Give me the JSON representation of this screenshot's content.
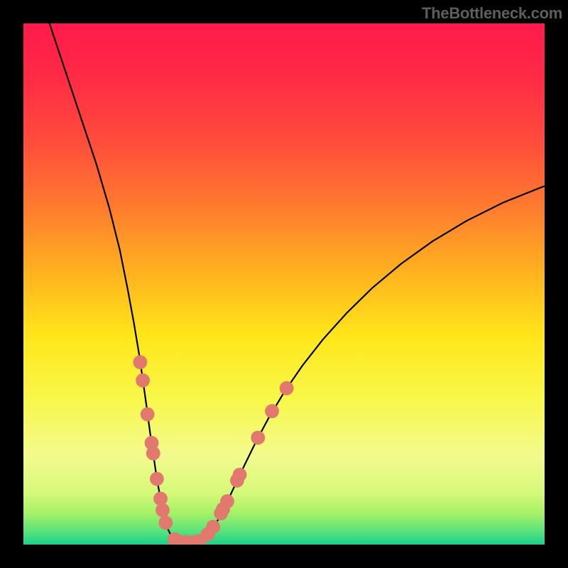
{
  "watermark": "TheBottleneck.com",
  "chart_data": {
    "type": "line",
    "title": "",
    "xlabel": "",
    "ylabel": "",
    "xlim": [
      0,
      100
    ],
    "ylim": [
      0,
      100
    ],
    "grid": false,
    "legend": false,
    "gradient_stops": [
      {
        "offset": 0.0,
        "color": "#ff1a4b"
      },
      {
        "offset": 0.1,
        "color": "#ff2a45"
      },
      {
        "offset": 0.22,
        "color": "#ff4a3c"
      },
      {
        "offset": 0.35,
        "color": "#ff7a2f"
      },
      {
        "offset": 0.48,
        "color": "#ffb31f"
      },
      {
        "offset": 0.6,
        "color": "#ffe61a"
      },
      {
        "offset": 0.72,
        "color": "#f8f84a"
      },
      {
        "offset": 0.83,
        "color": "#f3fa8d"
      },
      {
        "offset": 0.9,
        "color": "#d6f97a"
      },
      {
        "offset": 0.94,
        "color": "#a5f166"
      },
      {
        "offset": 0.97,
        "color": "#64e578"
      },
      {
        "offset": 1.0,
        "color": "#18d18a"
      }
    ],
    "series": [
      {
        "name": "left-branch",
        "stroke": "#000000",
        "x": [
          5.0,
          8.0,
          11.0,
          14.0,
          16.5,
          18.5,
          20.0,
          21.2,
          22.2,
          23.0,
          23.7,
          24.3,
          24.9,
          25.4,
          25.9,
          26.4,
          26.8,
          27.3,
          27.8,
          28.3,
          28.9,
          29.5
        ],
        "y": [
          100.0,
          91.0,
          82.0,
          73.0,
          64.5,
          56.5,
          49.0,
          42.5,
          36.5,
          31.0,
          26.0,
          21.5,
          17.5,
          14.0,
          11.0,
          8.3,
          6.0,
          4.2,
          2.8,
          1.8,
          1.0,
          0.5
        ]
      },
      {
        "name": "valley-floor",
        "stroke": "#000000",
        "x": [
          29.5,
          30.2,
          31.0,
          31.8,
          32.6,
          33.4,
          34.2
        ],
        "y": [
          0.5,
          0.3,
          0.25,
          0.25,
          0.3,
          0.4,
          0.6
        ]
      },
      {
        "name": "right-branch",
        "stroke": "#000000",
        "x": [
          34.2,
          35.2,
          36.3,
          37.6,
          39.0,
          40.6,
          42.4,
          44.5,
          47.0,
          50.0,
          53.5,
          57.5,
          62.0,
          67.0,
          72.5,
          78.5,
          85.0,
          92.0,
          100.0
        ],
        "y": [
          0.6,
          1.4,
          3.0,
          5.2,
          8.0,
          11.4,
          15.2,
          19.5,
          24.2,
          29.2,
          34.3,
          39.4,
          44.4,
          49.3,
          53.9,
          58.2,
          62.1,
          65.6,
          68.8
        ]
      }
    ],
    "markers": {
      "name": "highlight-dots",
      "color": "#e2796e",
      "radius": 1.35,
      "points": [
        {
          "x": 22.4,
          "y": 35.0
        },
        {
          "x": 22.9,
          "y": 31.5
        },
        {
          "x": 23.8,
          "y": 25.0
        },
        {
          "x": 24.6,
          "y": 19.5
        },
        {
          "x": 24.9,
          "y": 17.5
        },
        {
          "x": 25.6,
          "y": 12.6
        },
        {
          "x": 26.3,
          "y": 8.8
        },
        {
          "x": 26.7,
          "y": 6.6
        },
        {
          "x": 27.3,
          "y": 4.2
        },
        {
          "x": 29.0,
          "y": 1.0
        },
        {
          "x": 29.8,
          "y": 0.6
        },
        {
          "x": 31.3,
          "y": 0.5
        },
        {
          "x": 32.9,
          "y": 0.5
        },
        {
          "x": 33.8,
          "y": 0.7
        },
        {
          "x": 35.4,
          "y": 2.0
        },
        {
          "x": 36.4,
          "y": 3.4
        },
        {
          "x": 37.9,
          "y": 6.0
        },
        {
          "x": 38.3,
          "y": 6.8
        },
        {
          "x": 39.1,
          "y": 8.3
        },
        {
          "x": 41.0,
          "y": 12.3
        },
        {
          "x": 41.5,
          "y": 13.4
        },
        {
          "x": 45.0,
          "y": 20.5
        },
        {
          "x": 47.7,
          "y": 25.6
        },
        {
          "x": 50.5,
          "y": 30.0
        }
      ]
    }
  }
}
